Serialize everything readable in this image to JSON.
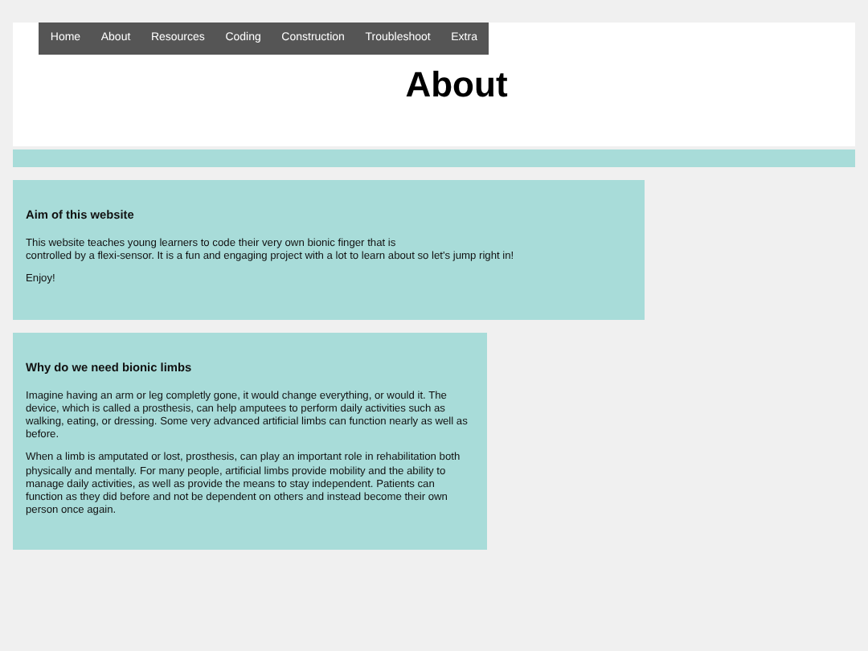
{
  "nav": [
    {
      "label": "Home"
    },
    {
      "label": "About"
    },
    {
      "label": "Resources"
    },
    {
      "label": "Coding"
    },
    {
      "label": "Construction"
    },
    {
      "label": "Troubleshoot"
    },
    {
      "label": "Extra"
    }
  ],
  "header": {
    "title": "About"
  },
  "sections": [
    {
      "heading": "Aim of this website",
      "paragraphs": [
        [
          "This website teaches young learners to code their very own bionic finger that is",
          "controlled by a flexi-sensor. It is a fun and engaging project with a lot to learn about so let's jump right in!"
        ],
        [
          "Enjoy!"
        ]
      ]
    },
    {
      "heading": "Why do we need bionic limbs",
      "paragraphs": [
        [
          "Imagine having an arm or leg completly gone, it would change everything, or would it. The device, which is called a prosthesis, can help amputees to perform daily activities such as walking, eating, or dressing. Some very advanced artificial limbs can function nearly as well as before."
        ],
        [
          "When a limb is amputated or lost, prosthesis, can play an important role in rehabilitation both physically and mentally. For many people, artificial limbs provide mobility and the ability to manage daily activities, as well as provide the means to stay independent. Patients can function as they did before and not be dependent on others and instead become their own person once again."
        ]
      ]
    }
  ]
}
